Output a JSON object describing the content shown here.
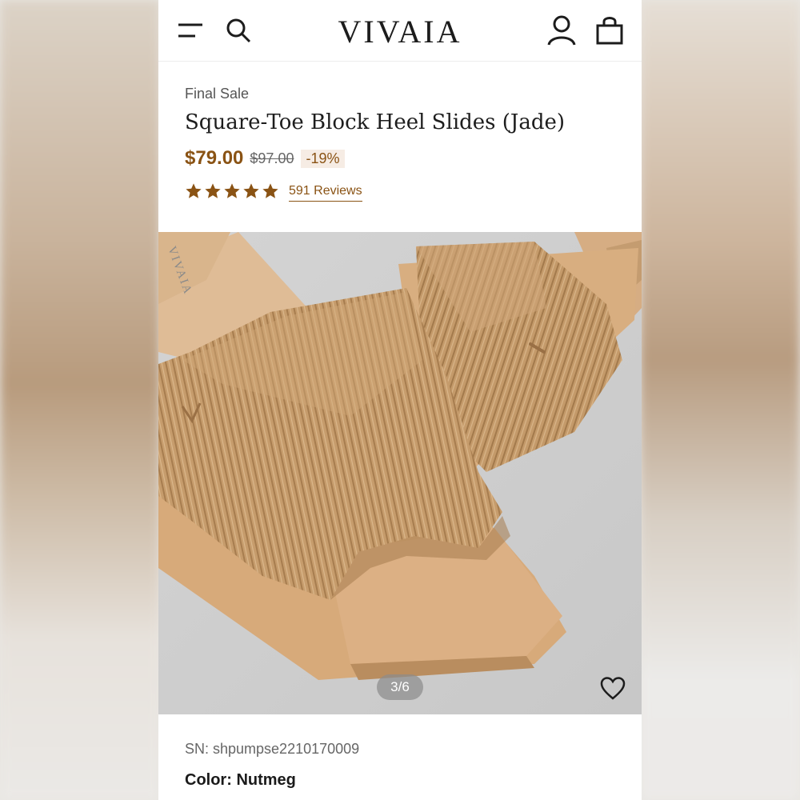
{
  "header": {
    "brand": "VIVAIA",
    "icons": [
      "menu-icon",
      "search-icon",
      "account-icon",
      "bag-icon"
    ]
  },
  "product": {
    "tag": "Final Sale",
    "title": "Square-Toe Block Heel Slides (Jade)",
    "price": "$79.00",
    "original_price": "$97.00",
    "discount": "-19%",
    "rating": 5,
    "reviews": "591 Reviews",
    "image_counter": "3/6",
    "image_brand_mark": "VIVAIA",
    "sn": "SN: shpumpse2210170009",
    "color_label": "Color:",
    "color_value": "Nutmeg"
  },
  "colors": {
    "accent": "#8a5314",
    "text": "#1d1d1d",
    "knit": "#c79d6e"
  }
}
